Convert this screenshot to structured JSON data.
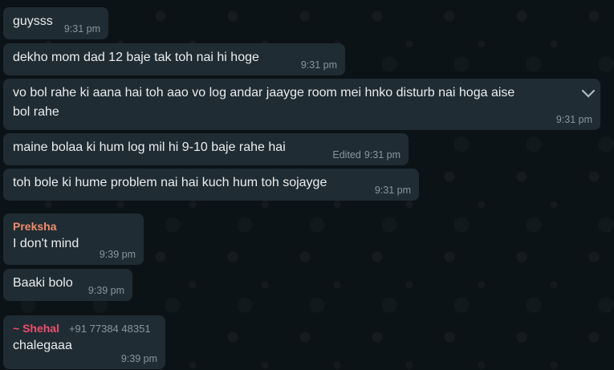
{
  "colors": {
    "background": "#0b141a",
    "bubble": "#202c33",
    "text": "#e9edef",
    "meta": "#8696a0",
    "sender_preksha": "#f28b6c",
    "sender_shehal": "#ef4f6d"
  },
  "messages": [
    {
      "text": "guysss",
      "time": "9:31 pm"
    },
    {
      "text": "dekho mom dad 12 baje tak toh nai hi hoge",
      "time": "9:31 pm"
    },
    {
      "text": "vo bol rahe ki aana hai toh aao vo log andar jaayge room mei hnko disturb nai hoga aise",
      "text2": "bol rahe",
      "time": "9:31 pm",
      "icon": "chevron-down-icon"
    },
    {
      "text": "maine bolaa ki hum log mil hi 9-10 baje rahe hai",
      "edited": "Edited",
      "time": "9:31 pm"
    },
    {
      "text": "toh bole ki hume problem nai hai kuch hum toh sojayge",
      "time": "9:31 pm"
    },
    {
      "sender": "Preksha",
      "text": "I don't mind",
      "time": "9:39 pm"
    },
    {
      "text": "Baaki bolo",
      "time": "9:39 pm"
    },
    {
      "sender": "~ Shehal",
      "phone": "+91 77384 48351",
      "text": "chalegaaa",
      "time": "9:39 pm"
    }
  ]
}
